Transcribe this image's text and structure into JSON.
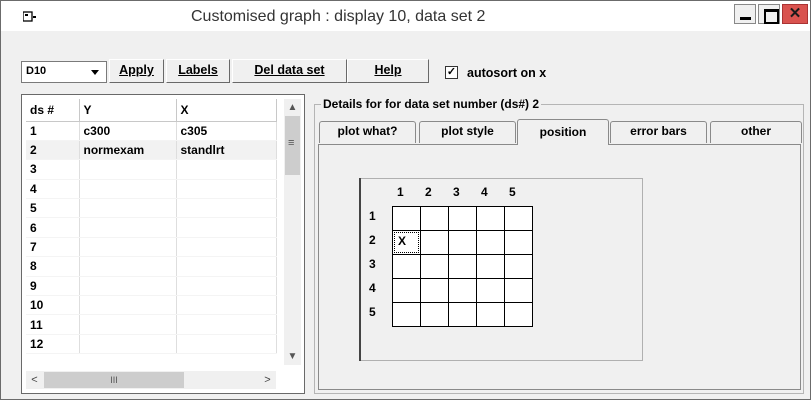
{
  "window": {
    "title": "Customised graph : display 10, data set 2"
  },
  "toolbar": {
    "display_select": "D10",
    "apply_label": "Apply",
    "labels_label": "Labels",
    "del_label": "Del data set",
    "help_label": "Help",
    "autosort_label": "autosort on x",
    "autosort_checked": true
  },
  "dataset_grid": {
    "columns": [
      "ds #",
      "Y",
      "X"
    ],
    "rows": [
      [
        "1",
        "c300",
        "c305"
      ],
      [
        "2",
        "normexam",
        "standlrt"
      ],
      [
        "3",
        "",
        ""
      ],
      [
        "4",
        "",
        ""
      ],
      [
        "5",
        "",
        ""
      ],
      [
        "6",
        "",
        ""
      ],
      [
        "7",
        "",
        ""
      ],
      [
        "8",
        "",
        ""
      ],
      [
        "9",
        "",
        ""
      ],
      [
        "10",
        "",
        ""
      ],
      [
        "11",
        "",
        ""
      ],
      [
        "12",
        "",
        ""
      ]
    ],
    "hscroll_grip": "III"
  },
  "details": {
    "group_label": "Details for for data set number (ds#) 2",
    "tabs": [
      "plot what?",
      "plot style",
      "position",
      "error bars",
      "other"
    ],
    "active_tab": "position"
  },
  "position_grid": {
    "col_headers": [
      "1",
      "2",
      "3",
      "4",
      "5"
    ],
    "row_headers": [
      "1",
      "2",
      "3",
      "4",
      "5"
    ],
    "marker": "X",
    "marker_row": 2,
    "marker_col": 1
  }
}
